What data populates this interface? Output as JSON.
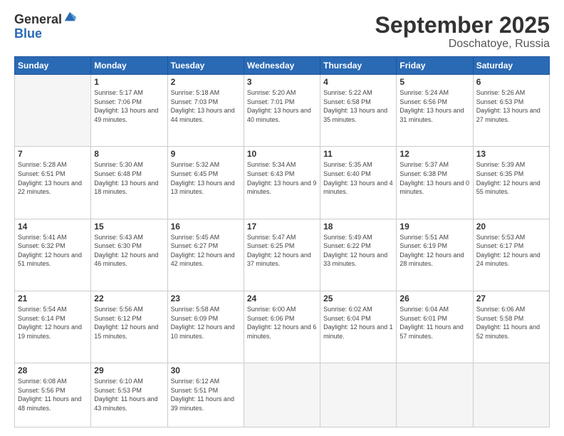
{
  "logo": {
    "general": "General",
    "blue": "Blue"
  },
  "title": "September 2025",
  "location": "Doschatoye, Russia",
  "days_header": [
    "Sunday",
    "Monday",
    "Tuesday",
    "Wednesday",
    "Thursday",
    "Friday",
    "Saturday"
  ],
  "weeks": [
    [
      {
        "day": "",
        "info": ""
      },
      {
        "day": "1",
        "info": "Sunrise: 5:17 AM\nSunset: 7:06 PM\nDaylight: 13 hours\nand 49 minutes."
      },
      {
        "day": "2",
        "info": "Sunrise: 5:18 AM\nSunset: 7:03 PM\nDaylight: 13 hours\nand 44 minutes."
      },
      {
        "day": "3",
        "info": "Sunrise: 5:20 AM\nSunset: 7:01 PM\nDaylight: 13 hours\nand 40 minutes."
      },
      {
        "day": "4",
        "info": "Sunrise: 5:22 AM\nSunset: 6:58 PM\nDaylight: 13 hours\nand 35 minutes."
      },
      {
        "day": "5",
        "info": "Sunrise: 5:24 AM\nSunset: 6:56 PM\nDaylight: 13 hours\nand 31 minutes."
      },
      {
        "day": "6",
        "info": "Sunrise: 5:26 AM\nSunset: 6:53 PM\nDaylight: 13 hours\nand 27 minutes."
      }
    ],
    [
      {
        "day": "7",
        "info": "Sunrise: 5:28 AM\nSunset: 6:51 PM\nDaylight: 13 hours\nand 22 minutes."
      },
      {
        "day": "8",
        "info": "Sunrise: 5:30 AM\nSunset: 6:48 PM\nDaylight: 13 hours\nand 18 minutes."
      },
      {
        "day": "9",
        "info": "Sunrise: 5:32 AM\nSunset: 6:45 PM\nDaylight: 13 hours\nand 13 minutes."
      },
      {
        "day": "10",
        "info": "Sunrise: 5:34 AM\nSunset: 6:43 PM\nDaylight: 13 hours\nand 9 minutes."
      },
      {
        "day": "11",
        "info": "Sunrise: 5:35 AM\nSunset: 6:40 PM\nDaylight: 13 hours\nand 4 minutes."
      },
      {
        "day": "12",
        "info": "Sunrise: 5:37 AM\nSunset: 6:38 PM\nDaylight: 13 hours\nand 0 minutes."
      },
      {
        "day": "13",
        "info": "Sunrise: 5:39 AM\nSunset: 6:35 PM\nDaylight: 12 hours\nand 55 minutes."
      }
    ],
    [
      {
        "day": "14",
        "info": "Sunrise: 5:41 AM\nSunset: 6:32 PM\nDaylight: 12 hours\nand 51 minutes."
      },
      {
        "day": "15",
        "info": "Sunrise: 5:43 AM\nSunset: 6:30 PM\nDaylight: 12 hours\nand 46 minutes."
      },
      {
        "day": "16",
        "info": "Sunrise: 5:45 AM\nSunset: 6:27 PM\nDaylight: 12 hours\nand 42 minutes."
      },
      {
        "day": "17",
        "info": "Sunrise: 5:47 AM\nSunset: 6:25 PM\nDaylight: 12 hours\nand 37 minutes."
      },
      {
        "day": "18",
        "info": "Sunrise: 5:49 AM\nSunset: 6:22 PM\nDaylight: 12 hours\nand 33 minutes."
      },
      {
        "day": "19",
        "info": "Sunrise: 5:51 AM\nSunset: 6:19 PM\nDaylight: 12 hours\nand 28 minutes."
      },
      {
        "day": "20",
        "info": "Sunrise: 5:53 AM\nSunset: 6:17 PM\nDaylight: 12 hours\nand 24 minutes."
      }
    ],
    [
      {
        "day": "21",
        "info": "Sunrise: 5:54 AM\nSunset: 6:14 PM\nDaylight: 12 hours\nand 19 minutes."
      },
      {
        "day": "22",
        "info": "Sunrise: 5:56 AM\nSunset: 6:12 PM\nDaylight: 12 hours\nand 15 minutes."
      },
      {
        "day": "23",
        "info": "Sunrise: 5:58 AM\nSunset: 6:09 PM\nDaylight: 12 hours\nand 10 minutes."
      },
      {
        "day": "24",
        "info": "Sunrise: 6:00 AM\nSunset: 6:06 PM\nDaylight: 12 hours\nand 6 minutes."
      },
      {
        "day": "25",
        "info": "Sunrise: 6:02 AM\nSunset: 6:04 PM\nDaylight: 12 hours\nand 1 minute."
      },
      {
        "day": "26",
        "info": "Sunrise: 6:04 AM\nSunset: 6:01 PM\nDaylight: 11 hours\nand 57 minutes."
      },
      {
        "day": "27",
        "info": "Sunrise: 6:06 AM\nSunset: 5:58 PM\nDaylight: 11 hours\nand 52 minutes."
      }
    ],
    [
      {
        "day": "28",
        "info": "Sunrise: 6:08 AM\nSunset: 5:56 PM\nDaylight: 11 hours\nand 48 minutes."
      },
      {
        "day": "29",
        "info": "Sunrise: 6:10 AM\nSunset: 5:53 PM\nDaylight: 11 hours\nand 43 minutes."
      },
      {
        "day": "30",
        "info": "Sunrise: 6:12 AM\nSunset: 5:51 PM\nDaylight: 11 hours\nand 39 minutes."
      },
      {
        "day": "",
        "info": ""
      },
      {
        "day": "",
        "info": ""
      },
      {
        "day": "",
        "info": ""
      },
      {
        "day": "",
        "info": ""
      }
    ]
  ]
}
